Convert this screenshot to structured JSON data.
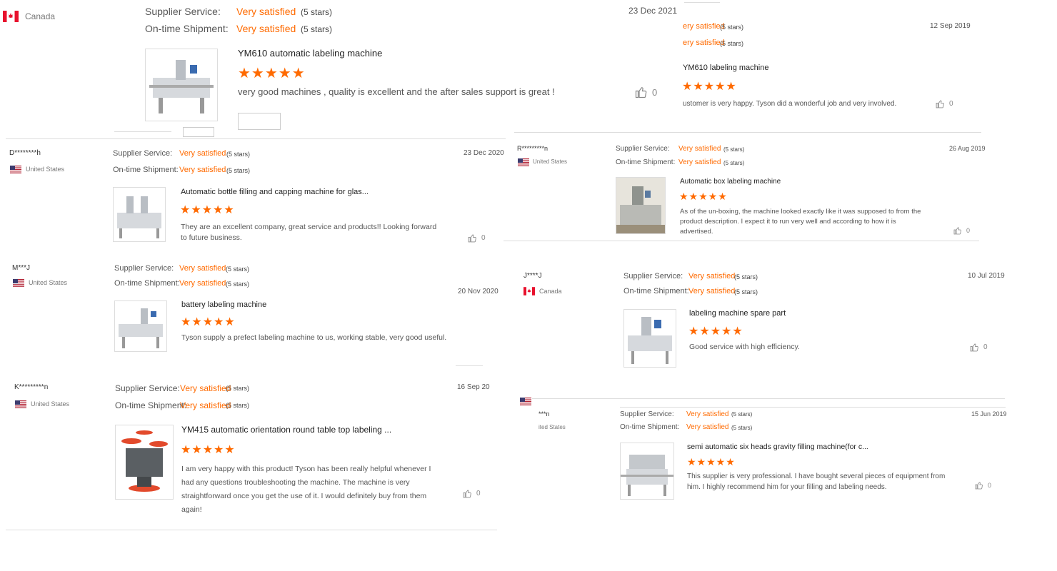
{
  "colors": {
    "accent": "#ff6a00",
    "divider": "#dddddd"
  },
  "icons": {
    "thumb": "thumbs-up-icon",
    "star": "star-icon"
  },
  "reviews": [
    {
      "buyer": "",
      "country": "Canada",
      "supplier_label": "Supplier Service:",
      "supplier_value": "Very satisfied",
      "supplier_stars": "(5 stars)",
      "shipment_label": "On-time Shipment:",
      "shipment_value": "Very satisfied",
      "shipment_stars": "(5 stars)",
      "date": "23 Dec 2021",
      "product": "YM610 automatic labeling machine",
      "rating": 5,
      "text": "very good machines , quality is excellent and the after sales support is great !",
      "likes": "0"
    },
    {
      "buyer": "",
      "country": "",
      "supplier_value": "ery satisfied",
      "supplier_stars": "(5 stars)",
      "shipment_value": "ery satisfied",
      "shipment_stars": "(5 stars)",
      "date": "12 Sep 2019",
      "product": "YM610 labeling machine",
      "rating": 5,
      "text": "ustomer is very happy. Tyson did a wonderful job and very involved.",
      "likes": "0"
    },
    {
      "buyer": "D********h",
      "country": "United States",
      "supplier_label": "Supplier Service:",
      "supplier_value": "Very satisfied",
      "supplier_stars": "(5 stars)",
      "shipment_label": "On-time Shipment:",
      "shipment_value": "Very satisfied",
      "shipment_stars": "(5 stars)",
      "date": "23 Dec 2020",
      "product": "Automatic bottle filling and capping machine for glas...",
      "rating": 5,
      "text": "They are an excellent company, great service and products!! Looking forward to future business.",
      "likes": "0"
    },
    {
      "buyer": "R*********n",
      "country": "United States",
      "supplier_label": "Supplier Service:",
      "supplier_value": "Very satisfied",
      "supplier_stars": "(5 stars)",
      "shipment_label": "On-time Shipment:",
      "shipment_value": "Very satisfied",
      "shipment_stars": "(5 stars)",
      "date": "26 Aug 2019",
      "product": "Automatic box labeling machine",
      "rating": 5,
      "text": "As of the un-boxing, the machine looked exactly like it was supposed to from the product description. I expect it to run very well and according to how it is advertised.",
      "likes": "0"
    },
    {
      "buyer": "M***J",
      "country": "United States",
      "supplier_label": "Supplier Service:",
      "supplier_value": "Very satisfied",
      "supplier_stars": "(5 stars)",
      "shipment_label": "On-time Shipment:",
      "shipment_value": "Very satisfied",
      "shipment_stars": "(5 stars)",
      "date": "20 Nov 2020",
      "product": "battery labeling machine",
      "rating": 5,
      "text": "Tyson supply a prefect labeling machine to us, working stable, very good useful.",
      "likes": ""
    },
    {
      "buyer": "J****J",
      "country": "Canada",
      "supplier_label": "Supplier Service:",
      "supplier_value": "Very satisfied",
      "supplier_stars": "(5 stars)",
      "shipment_label": "On-time Shipment:",
      "shipment_value": "Very satisfied",
      "shipment_stars": "(5 stars)",
      "date": "10 Jul 2019",
      "product": "labeling machine spare part",
      "rating": 5,
      "text": "Good service with high efficiency.",
      "likes": "0"
    },
    {
      "buyer": "K*********n",
      "country": "United States",
      "supplier_label": "Supplier Service:",
      "supplier_value": "Very satisfied",
      "supplier_stars": "(5 stars)",
      "shipment_label": "On-time Shipment:",
      "shipment_value": "Very satisfied",
      "shipment_stars": "(5 stars)",
      "date": "16 Sep 20",
      "product": "YM415 automatic orientation round table top labeling ...",
      "rating": 5,
      "text": "I am very happy with this product! Tyson has been really helpful whenever I had any questions troubleshooting the machine. The machine is very straightforward once you get the use of it. I would definitely buy from them again!",
      "likes": "0"
    },
    {
      "buyer": "***n",
      "country": "ited States",
      "supplier_label": "Supplier Service:",
      "supplier_value": "Very satisfied",
      "supplier_stars": "(5 stars)",
      "shipment_label": "On-time Shipment:",
      "shipment_value": "Very satisfied",
      "shipment_stars": "(5 stars)",
      "date": "15 Jun 2019",
      "product": "semi automatic six heads gravity filling machine(for c...",
      "rating": 5,
      "text": "This supplier is very professional. I have bought several pieces of equipment from him. I highly recommend him for your filling and labeling needs.",
      "likes": "0"
    }
  ]
}
